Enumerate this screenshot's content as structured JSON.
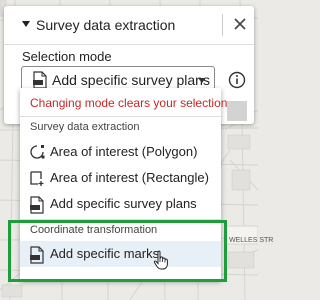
{
  "panel": {
    "title": "Survey data extraction",
    "selection_label": "Selection mode",
    "selected_value": "Add specific survey plans"
  },
  "dropdown": {
    "warning": "Changing mode clears your selection",
    "groups": [
      {
        "label": "Survey data extraction",
        "items": [
          {
            "label": "Area of interest (Polygon)",
            "icon": "polygon-icon"
          },
          {
            "label": "Area of interest (Rectangle)",
            "icon": "rectangle-select-icon"
          },
          {
            "label": "Add specific survey plans",
            "icon": "survey-plan-icon"
          }
        ]
      },
      {
        "label": "Coordinate transformation",
        "items": [
          {
            "label": "Add specific marks",
            "icon": "marks-icon",
            "hovered": true
          }
        ]
      }
    ]
  },
  "map": {
    "street_label": "WELLES STR"
  },
  "colors": {
    "warning": "#c62828",
    "highlight": "#1e9e3a",
    "hover": "#e8f0f7"
  }
}
